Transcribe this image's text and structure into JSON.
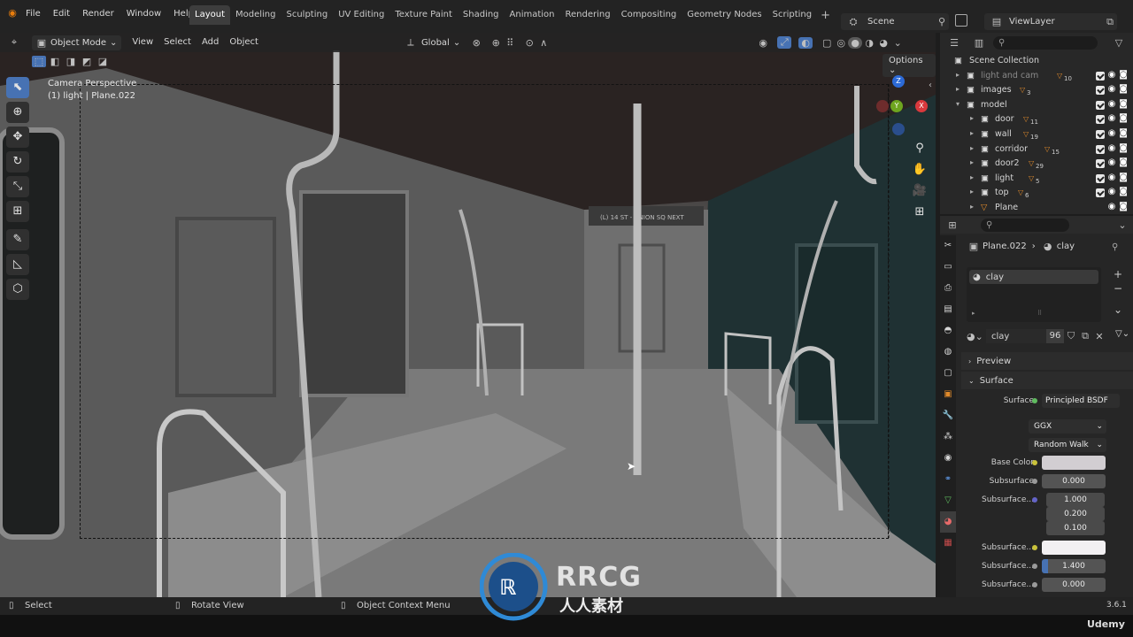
{
  "topbar": {
    "menus": [
      "File",
      "Edit",
      "Render",
      "Window",
      "Help"
    ],
    "workspaces": [
      "Layout",
      "Modeling",
      "Sculpting",
      "UV Editing",
      "Texture Paint",
      "Shading",
      "Animation",
      "Rendering",
      "Compositing",
      "Geometry Nodes",
      "Scripting"
    ],
    "active_workspace": "Layout",
    "add_workspace": "+",
    "scene": "Scene",
    "view_layer": "ViewLayer"
  },
  "viewport": {
    "mode": "Object Mode",
    "menus": [
      "View",
      "Select",
      "Add",
      "Object"
    ],
    "orientation": "Global",
    "camera_label": "Camera Perspective",
    "object_label": "(1) light | Plane.022",
    "options": "Options",
    "gizmo": {
      "z": "Z",
      "y": "Y",
      "x": "X"
    },
    "sign_text": "(L) 14 ST - UNION SQ NEXT"
  },
  "outliner": {
    "root": "Scene Collection",
    "items": [
      {
        "name": "light and cam",
        "count": "10",
        "indent": 1,
        "dim": true
      },
      {
        "name": "images",
        "count": "3",
        "indent": 1
      },
      {
        "name": "model",
        "count": "",
        "indent": 1,
        "open": true
      },
      {
        "name": "door",
        "count": "11",
        "indent": 2
      },
      {
        "name": "wall",
        "count": "19",
        "indent": 2
      },
      {
        "name": "corridor",
        "count": "15",
        "indent": 2
      },
      {
        "name": "door2",
        "count": "29",
        "indent": 2
      },
      {
        "name": "light",
        "count": "5",
        "indent": 2
      },
      {
        "name": "top",
        "count": "6",
        "indent": 2
      },
      {
        "name": "Plane",
        "count": "",
        "indent": 2
      }
    ]
  },
  "properties": {
    "breadcrumb_object": "Plane.022",
    "breadcrumb_material": "clay",
    "slot_name": "clay",
    "material_name": "clay",
    "users": "96",
    "panels": {
      "preview": "Preview",
      "surface": "Surface"
    },
    "surface_label": "Surface",
    "surface_shader": "Principled BSDF",
    "distribution": "GGX",
    "subsurface_method": "Random Walk",
    "fields": [
      {
        "label": "Base Color",
        "value": "",
        "type": "color",
        "color": "#d2ced2",
        "socket": "#c9c23a"
      },
      {
        "label": "Subsurface",
        "value": "0.000",
        "type": "num",
        "socket": "#9a9a9a"
      },
      {
        "label": "Subsurface...",
        "value": "1.000",
        "type": "vec",
        "socket": "#6464c8"
      },
      {
        "label": "",
        "value": "0.200",
        "type": "vec"
      },
      {
        "label": "",
        "value": "0.100",
        "type": "vec"
      },
      {
        "label": "Subsurface...",
        "value": "",
        "type": "color",
        "color": "#f2f0f2",
        "socket": "#c9c23a"
      },
      {
        "label": "Subsurface...",
        "value": "1.400",
        "type": "num",
        "socket": "#9a9a9a",
        "fill": true
      },
      {
        "label": "Subsurface...",
        "value": "0.000",
        "type": "num",
        "socket": "#9a9a9a"
      }
    ]
  },
  "statusbar": {
    "select": "Select",
    "rotate": "Rotate View",
    "context": "Object Context Menu",
    "version": "3.6.1"
  },
  "watermark": {
    "brand": "RRCG",
    "sub": "人人素材",
    "site": "Udemy"
  },
  "colors": {
    "accent": "#4772b3",
    "axis_x": "#d9393d",
    "axis_y": "#6ea51f",
    "axis_z": "#2c6ad6"
  }
}
